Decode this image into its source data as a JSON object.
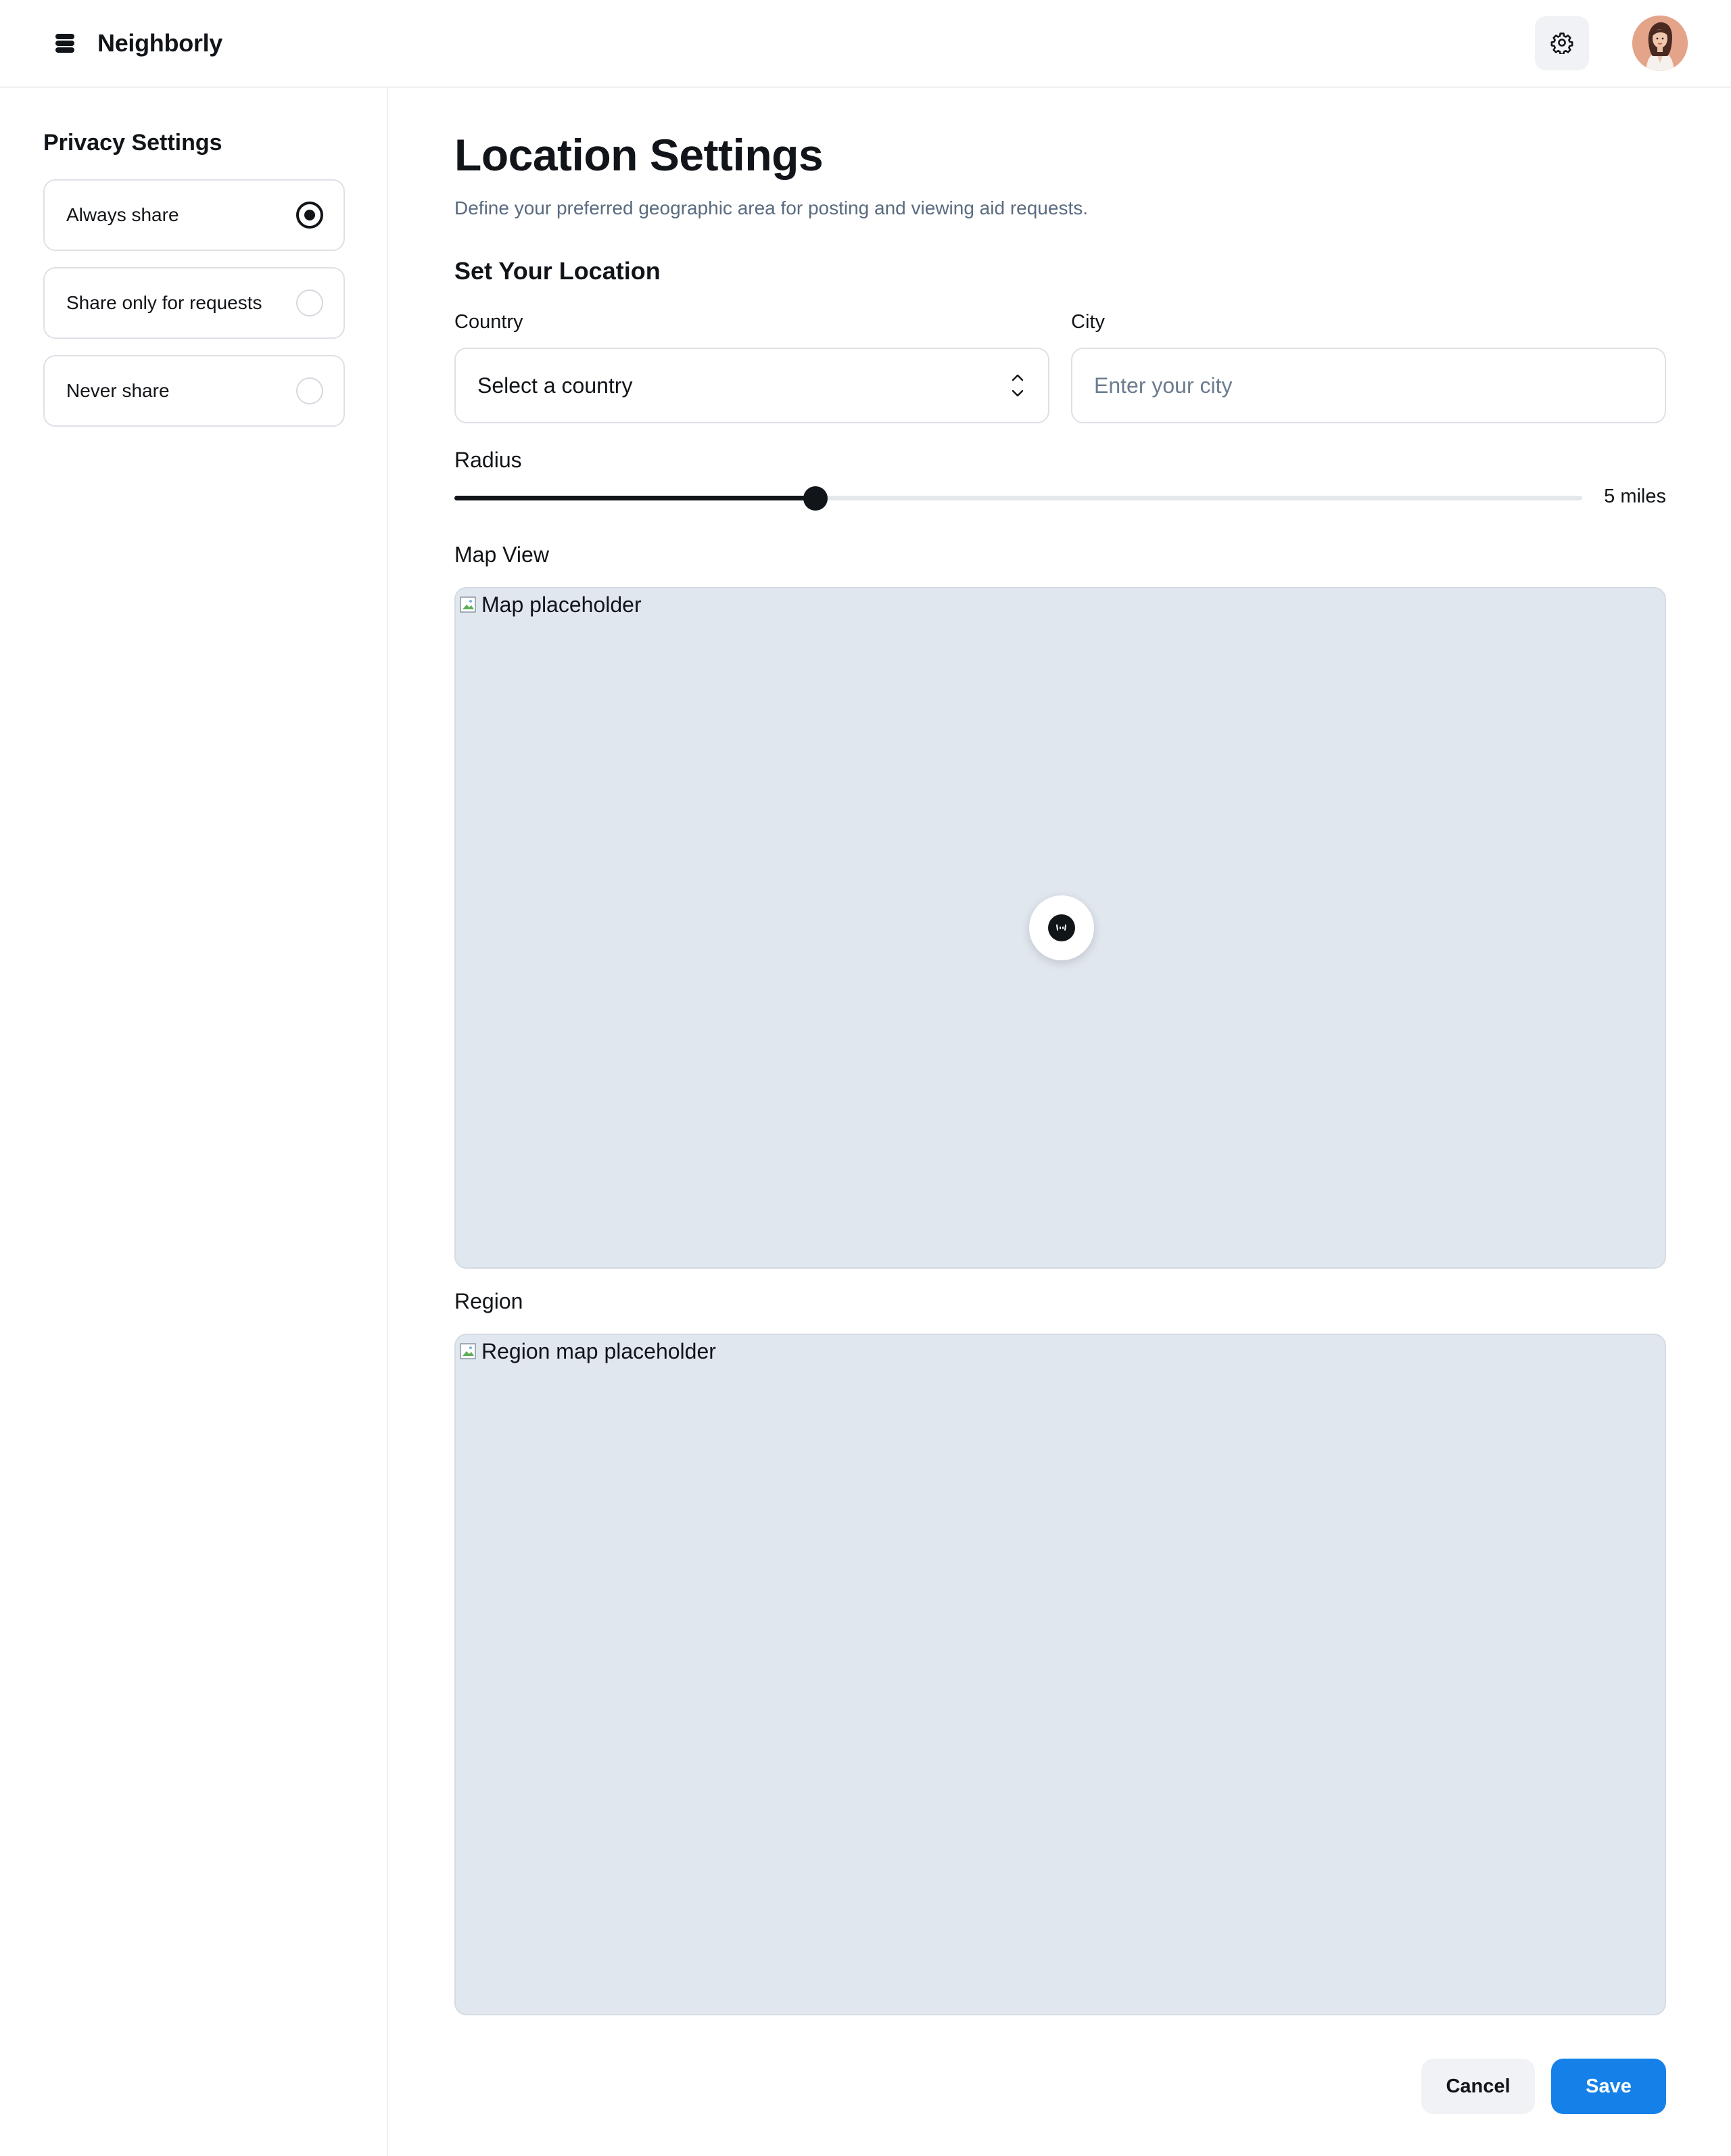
{
  "app": {
    "name": "Neighborly",
    "icons": {
      "brand": "stack-logo-icon",
      "settings": "gear-icon",
      "avatar": "user-avatar"
    }
  },
  "sidebar": {
    "title": "Privacy Settings",
    "options": [
      {
        "label": "Always share",
        "selected": true
      },
      {
        "label": "Share only for requests",
        "selected": false
      },
      {
        "label": "Never share",
        "selected": false
      }
    ]
  },
  "main": {
    "title": "Location Settings",
    "description": "Define your preferred geographic area for posting and viewing aid requests.",
    "section_title": "Set Your Location",
    "country": {
      "label": "Country",
      "value": "Select a country"
    },
    "city": {
      "label": "City",
      "placeholder": "Enter your city",
      "value": ""
    },
    "radius": {
      "label": "Radius",
      "value_text": "5 miles",
      "fill_fraction": 0.32
    },
    "map_view": {
      "label": "Map View",
      "alt": "Map placeholder",
      "pin_icon": "location-pin-icon"
    },
    "region": {
      "label": "Region",
      "alt": "Region map placeholder"
    }
  },
  "actions": {
    "cancel": "Cancel",
    "save": "Save"
  },
  "colors": {
    "primary": "#1581e8",
    "text": "#111418",
    "muted": "#5a6b7f",
    "map_bg": "#e1e7ef"
  }
}
